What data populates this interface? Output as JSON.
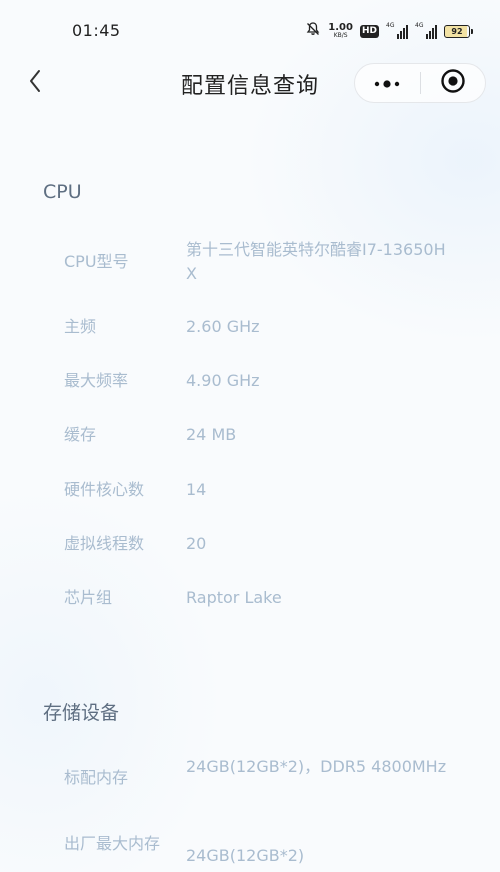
{
  "status_bar": {
    "time": "01:45",
    "net_speed_value": "1.00",
    "net_speed_unit": "KB/S",
    "hd_label": "HD",
    "signal1_label": "4G",
    "signal2_label": "4G",
    "battery_level": "92",
    "icons": [
      "mute-bell-icon",
      "hd-icon",
      "signal-icon",
      "signal-icon",
      "battery-icon"
    ]
  },
  "nav": {
    "title": "配置信息查询",
    "back_icon": "chevron-left-icon",
    "more_icon": "more-dots-icon",
    "close_icon": "target-close-icon"
  },
  "sections": {
    "cpu": {
      "title": "CPU",
      "rows": [
        {
          "label": "CPU型号",
          "value": "第十三代智能英特尔酷睿I7-13650HX"
        },
        {
          "label": "主频",
          "value": "2.60 GHz"
        },
        {
          "label": "最大频率",
          "value": "4.90 GHz"
        },
        {
          "label": "缓存",
          "value": "24 MB"
        },
        {
          "label": "硬件核心数",
          "value": "14"
        },
        {
          "label": "虚拟线程数",
          "value": "20"
        },
        {
          "label": "芯片组",
          "value": "Raptor Lake"
        }
      ]
    },
    "storage": {
      "title": "存储设备",
      "rows": [
        {
          "label": "标配内存",
          "value": "24GB(12GB*2)，DDR5 4800MHz"
        },
        {
          "label": "出厂最大内存",
          "value": "24GB(12GB*2)"
        }
      ]
    }
  },
  "colors": {
    "section_title": "#5f6f82",
    "row_text": "#a9bccf",
    "background": "#f9fbfd"
  }
}
